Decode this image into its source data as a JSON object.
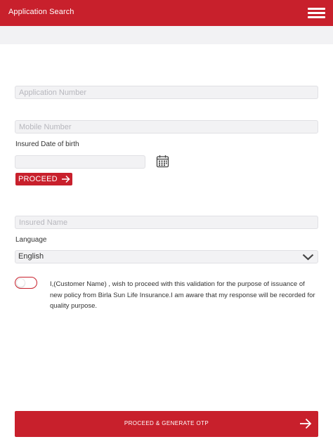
{
  "header": {
    "title": "Application Search"
  },
  "form": {
    "application_number": {
      "value": "",
      "placeholder": "Application Number"
    },
    "mobile_number": {
      "value": "",
      "placeholder": "Mobile Number"
    },
    "dob_label": "Insured Date of birth",
    "dob": {
      "value": "",
      "placeholder": ""
    },
    "proceed_label": "PROCEED",
    "insured_name": {
      "value": "",
      "placeholder": "Insured Name"
    },
    "language_label": "Language",
    "language_selected": "English",
    "consent_text": "I,(Customer Name) , wish to proceed with this validation for the purpose of issuance of new policy from Birla Sun Life Insurance.I am aware that my response will be recorded for quality purpose.",
    "consent_toggle_on": false
  },
  "footer": {
    "generate_label": "PROCEED & GENERATE OTP"
  },
  "colors": {
    "brand_red": "#c8202c",
    "field_bg": "#f2f2f4"
  },
  "icons": [
    "menu-icon",
    "calendar-icon",
    "arrow-right-icon",
    "chevron-down-icon"
  ]
}
